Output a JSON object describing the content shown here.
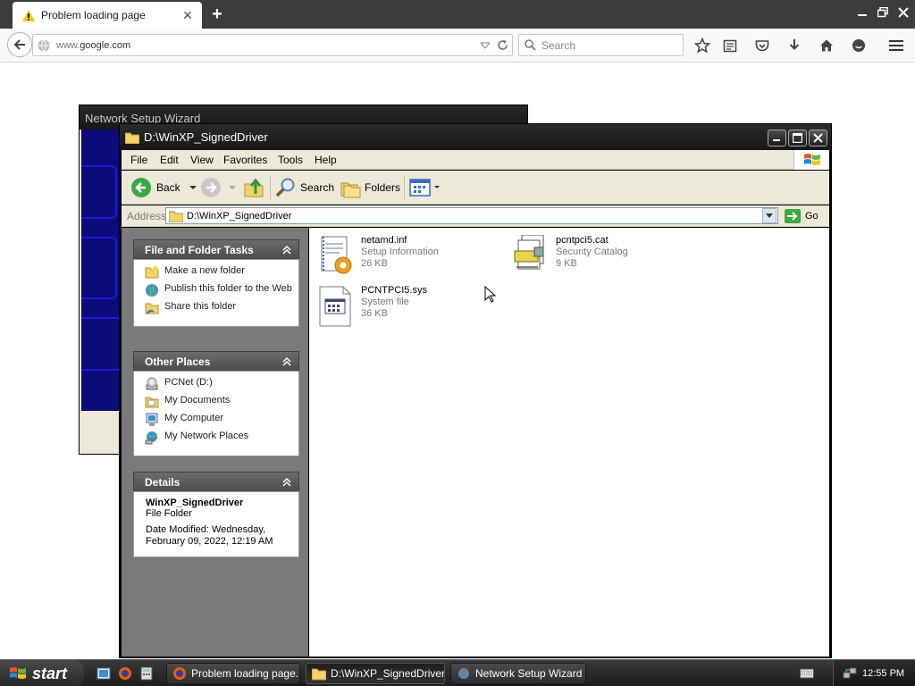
{
  "browser": {
    "tab_title": "Problem loading page",
    "url_prefix": "www.",
    "url_domain": "google.com",
    "search_placeholder": "Search"
  },
  "wizard": {
    "title": "Network Setup Wizard"
  },
  "explorer": {
    "title": "D:\\WinXP_SignedDriver",
    "menu": [
      "File",
      "Edit",
      "View",
      "Favorites",
      "Tools",
      "Help"
    ],
    "toolbar": {
      "back": "Back",
      "search": "Search",
      "folders": "Folders"
    },
    "address": {
      "label": "Address",
      "value": "D:\\WinXP_SignedDriver",
      "go": "Go"
    },
    "tasks_panel": {
      "title": "File and Folder Tasks",
      "items": [
        "Make a new folder",
        "Publish this folder to the Web",
        "Share this folder"
      ]
    },
    "other_places": {
      "title": "Other Places",
      "items": [
        "PCNet (D:)",
        "My Documents",
        "My Computer",
        "My Network Places"
      ]
    },
    "details": {
      "title": "Details",
      "name": "WinXP_SignedDriver",
      "type": "File Folder",
      "modified_line1": "Date Modified: Wednesday,",
      "modified_line2": "February 09, 2022, 12:19 AM"
    },
    "files": [
      {
        "name": "netamd.inf",
        "type": "Setup Information",
        "size": "26 KB",
        "icon": "setup-info-icon"
      },
      {
        "name": "pcntpci5.cat",
        "type": "Security Catalog",
        "size": "9 KB",
        "icon": "security-catalog-icon"
      },
      {
        "name": "PCNTPCI5.sys",
        "type": "System file",
        "size": "36 KB",
        "icon": "system-file-icon"
      }
    ]
  },
  "taskbar": {
    "start": "start",
    "tasks": [
      "Problem loading page...",
      "D:\\WinXP_SignedDriver",
      "Network Setup Wizard"
    ],
    "clock": "12:55 PM"
  }
}
